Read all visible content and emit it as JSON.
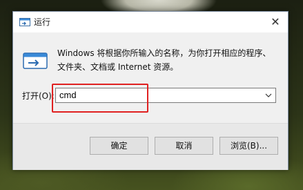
{
  "dialog": {
    "title": "运行",
    "close_glyph": "✕",
    "description": "Windows 将根据你所输入的名称，为你打开相应的程序、文件夹、文档或 Internet 资源。",
    "open_label": "打开(O):",
    "command_value": "cmd",
    "buttons": {
      "ok": "确定",
      "cancel": "取消",
      "browse": "浏览(B)..."
    }
  },
  "icons": {
    "title": "run-icon",
    "app": "run-icon",
    "combo_arrow": "chevron-down-icon"
  },
  "colors": {
    "highlight_box": "#e02020",
    "dialog_bg": "#f0f0f0"
  }
}
